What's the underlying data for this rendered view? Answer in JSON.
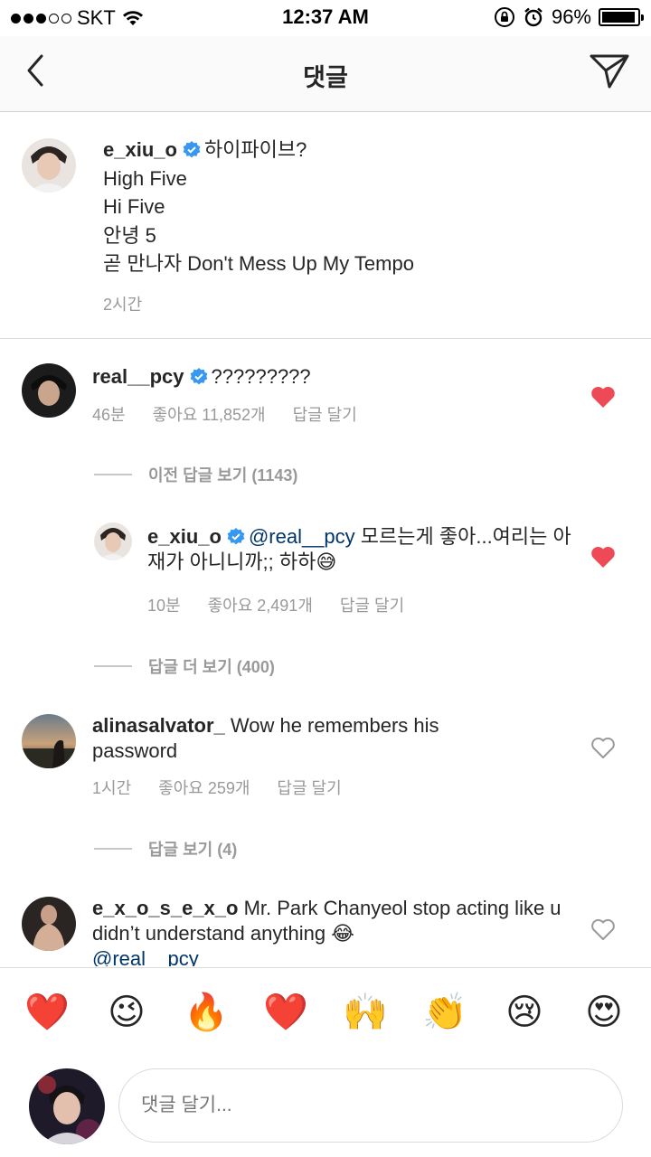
{
  "status_bar": {
    "carrier": "SKT",
    "time": "12:37 AM",
    "battery": "96%",
    "battery_level": 0.96,
    "signal_bars": 3
  },
  "nav": {
    "title": "댓글",
    "back_icon": "chevron-left-icon",
    "send_icon": "paper-plane-icon"
  },
  "caption": {
    "username": "e_xiu_o",
    "first_line": "하이파이브?",
    "lines": [
      "High Five",
      "Hi Five",
      "안녕 5",
      "곧 만나자 Don't Mess Up My Tempo"
    ],
    "time": "2시간"
  },
  "comments": [
    {
      "username": "real__pcy",
      "text": "?????????",
      "time": "46분",
      "likes": "좋아요 11,852개",
      "reply": "답글 달기",
      "liked": true
    },
    {
      "username": "alinasalvator_",
      "text": "Wow he remembers his password",
      "time": "1시간",
      "likes": "좋아요 259개",
      "reply": "답글 달기",
      "liked": false
    },
    {
      "username": "e_x_o_s_e_x_o",
      "text": "Mr. Park Chanyeol stop acting like u didn’t understand anything 😂",
      "mention": "@real__pcy",
      "liked": false
    }
  ],
  "view_previous": "이전 답글 보기 (1143)",
  "reply": {
    "username": "e_xiu_o",
    "mention": "@real__pcy",
    "text": "모르는게 좋아...여리는 아재가 아니니까;; 하하😅",
    "time": "10분",
    "likes": "좋아요 2,491개",
    "reply": "답글 달기",
    "liked": true
  },
  "view_more_replies": "답글 더 보기 (400)",
  "view_replies": "답글 보기 (4)",
  "emoji_bar": [
    "❤️",
    "😉",
    "🔥",
    "❤️",
    "🙌",
    "👏",
    "😢",
    "😍"
  ],
  "composer": {
    "placeholder": "댓글 달기..."
  },
  "colors": {
    "heart_active": "#ed4956",
    "verified": "#3897f0",
    "meta": "#999999"
  }
}
